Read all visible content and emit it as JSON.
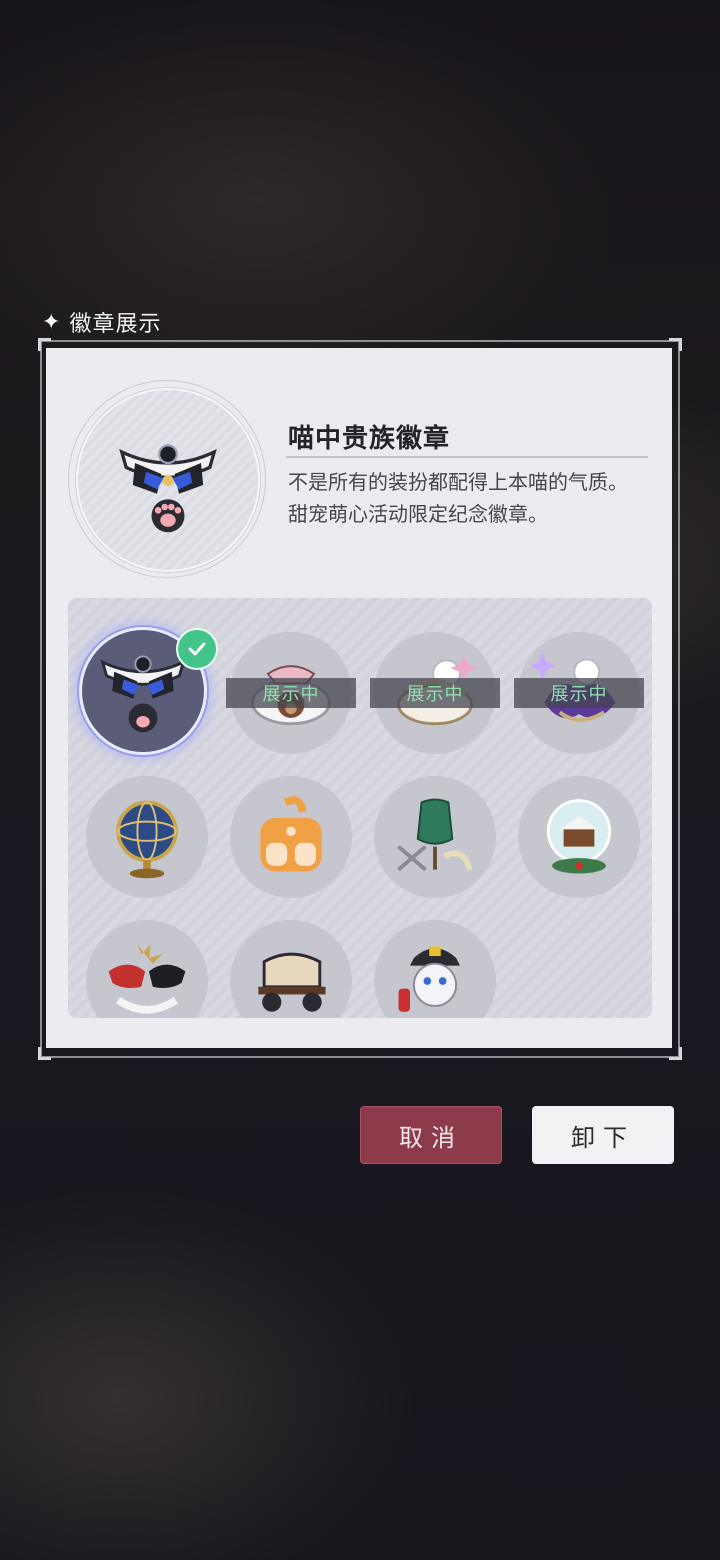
{
  "section": {
    "icon": "sparkle-icon",
    "title": "徽章展示"
  },
  "selected_badge": {
    "name": "喵中贵族徽章",
    "description": "不是所有的装扮都配得上本喵的气质。甜宠萌心活动限定纪念徽章。",
    "icon": "cat-collar-badge-icon"
  },
  "badges": [
    {
      "icon": "cat-collar-badge-icon",
      "state": "selected",
      "label": ""
    },
    {
      "icon": "bear-lace-badge-icon",
      "state": "shown",
      "label": "展示中"
    },
    {
      "icon": "rabbit-ribbon-badge-icon",
      "state": "shown",
      "label": "展示中"
    },
    {
      "icon": "purple-cat-badge-icon",
      "state": "shown",
      "label": "展示中"
    },
    {
      "icon": "globe-armillary-badge-icon",
      "state": "normal",
      "label": ""
    },
    {
      "icon": "orange-cat-badge-icon",
      "state": "normal",
      "label": ""
    },
    {
      "icon": "sewing-mannequin-badge-icon",
      "state": "normal",
      "label": ""
    },
    {
      "icon": "snow-globe-badge-icon",
      "state": "normal",
      "label": ""
    },
    {
      "icon": "masquerade-mask-badge-icon",
      "state": "normal",
      "label": ""
    },
    {
      "icon": "wagon-badge-icon",
      "state": "normal",
      "label": ""
    },
    {
      "icon": "firefighter-dog-badge-icon",
      "state": "normal",
      "label": ""
    }
  ],
  "buttons": {
    "cancel": "取消",
    "unload": "卸下"
  },
  "colors": {
    "cancel_bg": "#8d3b4a",
    "check_green": "#43c48a",
    "shown_text": "#8fe0b0"
  }
}
